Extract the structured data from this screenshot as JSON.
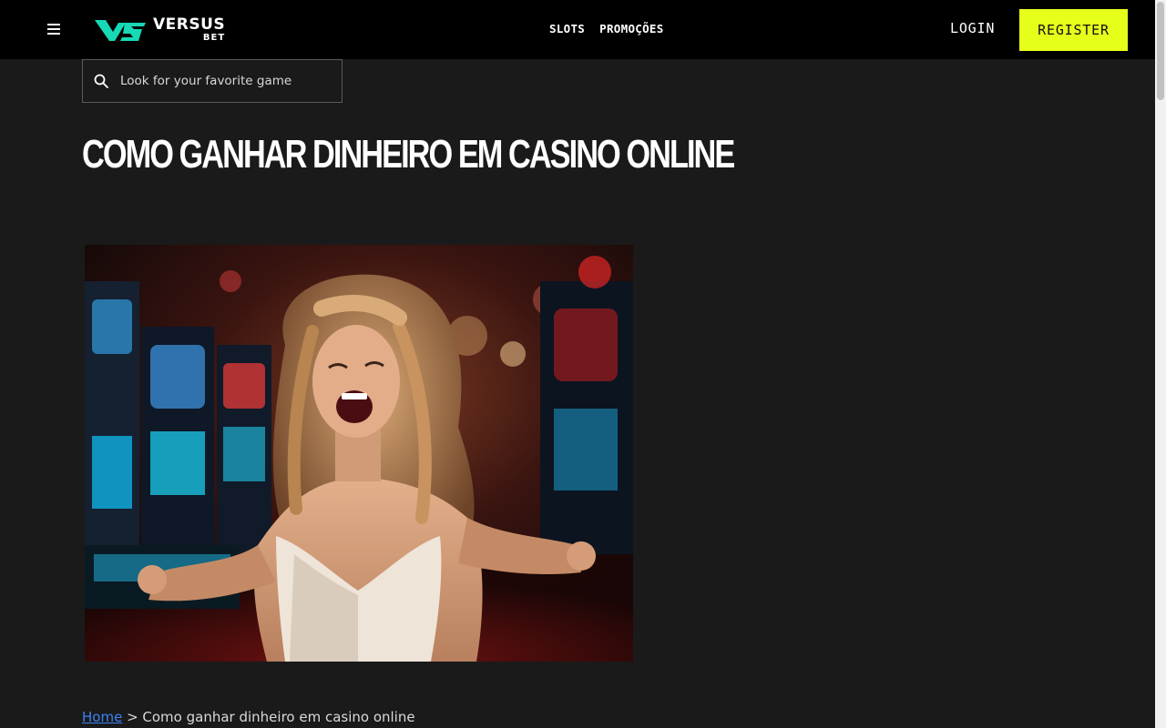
{
  "header": {
    "logo": {
      "word": "VERSUS",
      "sub": "BET"
    },
    "nav": [
      {
        "label": "SLOTS"
      },
      {
        "label": "PROMOÇÕES"
      }
    ],
    "login_label": "LOGIN",
    "register_label": "REGISTER",
    "colors": {
      "accent": "#e6ff1a",
      "logo_mark": "#17d9b6"
    }
  },
  "search": {
    "placeholder": "Look for your favorite game"
  },
  "page": {
    "title": "COMO GANHAR DINHEIRO EM CASINO ONLINE"
  },
  "breadcrumb": {
    "home": "Home",
    "separator": " > ",
    "current": "Como ganhar dinheiro em casino online"
  }
}
